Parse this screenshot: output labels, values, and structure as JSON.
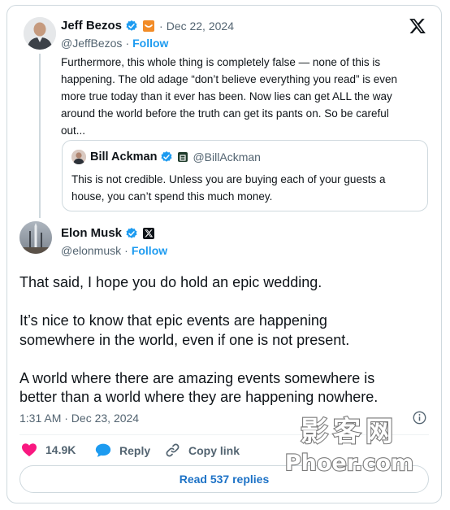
{
  "quoted_tweet": {
    "author_name": "Jeff Bezos",
    "handle": "@JeffBezos",
    "separator": "·",
    "date": "Dec 22, 2024",
    "follow_label": "Follow",
    "text": "Furthermore, this whole thing is completely false — none of this is\nhappening. The old adage “don’t believe everything you read” is even\nmore true today than it ever has been. Now lies can get ALL the way\naround the world before the truth can get its pants on. So be careful\nout...",
    "nested_quote": {
      "author_name": "Bill Ackman",
      "handle": "@BillAckman",
      "text": "This is not credible. Unless you are buying each of your guests a\nhouse, you can’t spend this much money."
    }
  },
  "main_tweet": {
    "author_name": "Elon Musk",
    "handle": "@elonmusk",
    "separator": "·",
    "follow_label": "Follow",
    "text": "That said, I hope you do hold an epic wedding.\n\nIt’s nice to know that epic events are happening\nsomewhere in the world, even if one is not present.\n\nA world where there are amazing events somewhere is\nbetter than a world where they are happening nowhere.",
    "timestamp": "1:31 AM · Dec 23, 2024"
  },
  "actions": {
    "like_count": "14.9K",
    "reply_label": "Reply",
    "copy_link_label": "Copy link"
  },
  "read_replies_label": "Read 537 replies",
  "watermark": {
    "line1": "影客网",
    "line2": "Phoer.com"
  },
  "icons": {
    "platform": "x-logo-icon",
    "verified": "verified-badge-icon",
    "like": "heart-icon",
    "reply": "speech-bubble-icon",
    "copy_link": "link-icon",
    "info": "info-icon"
  },
  "colors": {
    "accent": "#1d9bf0",
    "like": "#f91880",
    "text": "#0f1419",
    "muted": "#536471",
    "border": "#cfd9de"
  }
}
